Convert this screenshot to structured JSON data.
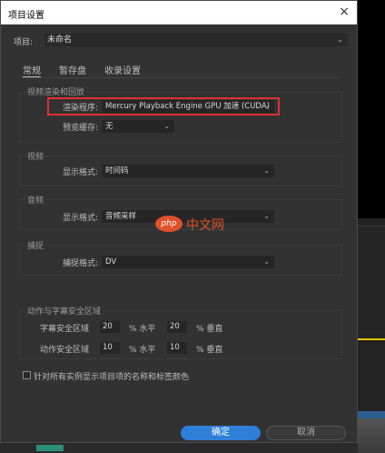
{
  "dialog": {
    "title": "项目设置",
    "close_icon": "×"
  },
  "project": {
    "label": "项目:",
    "value": "未命名"
  },
  "tabs": [
    {
      "label": "常规",
      "active": true
    },
    {
      "label": "暂存盘",
      "active": false
    },
    {
      "label": "收录设置",
      "active": false
    }
  ],
  "render": {
    "header": "视频渲染和回放",
    "renderer_label": "渲染程序:",
    "renderer_value": "Mercury Playback Engine GPU 加速 (CUDA)",
    "preview_cache_label": "预览缓存:",
    "preview_cache_value": "无"
  },
  "video": {
    "header": "视频",
    "format_label": "显示格式:",
    "format_value": "时间码"
  },
  "audio": {
    "header": "音频",
    "format_label": "显示格式:",
    "format_value": "音频采样"
  },
  "capture": {
    "header": "捕捉",
    "format_label": "捕捉格式:",
    "format_value": "DV"
  },
  "safe": {
    "header": "动作与字幕安全区域",
    "title_label": "字幕安全区域",
    "title_h": "20",
    "title_v": "20",
    "action_label": "动作安全区域",
    "action_h": "10",
    "action_v": "10",
    "h_unit": "% 水平",
    "v_unit": "% 垂直"
  },
  "checkbox": {
    "label": "针对所有实例显示项目项的名称和标签颜色",
    "checked": false
  },
  "buttons": {
    "ok": "确定",
    "cancel": "取消"
  },
  "watermark": {
    "logo": "php",
    "text": "中文网"
  },
  "colors": {
    "accent": "#2f7fd8",
    "highlight": "#e03030",
    "watermark": "#e0502a"
  }
}
